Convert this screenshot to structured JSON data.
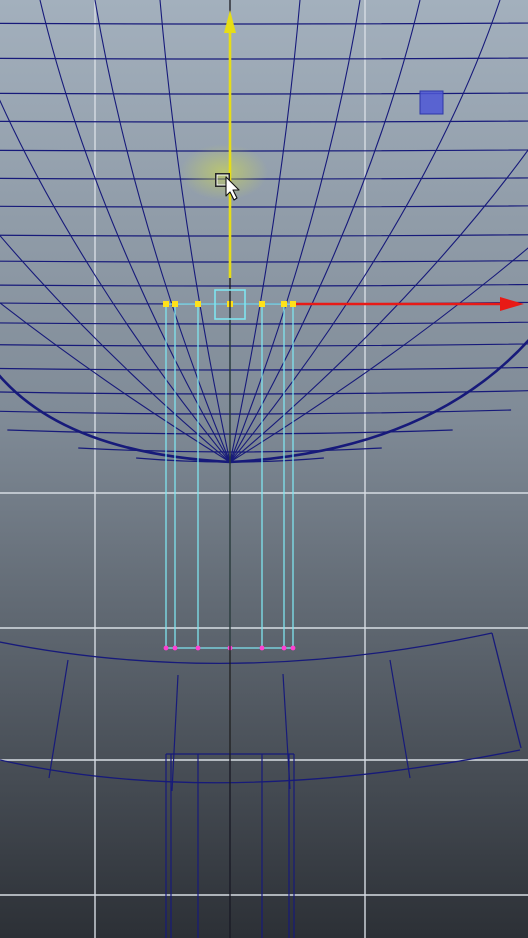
{
  "viewport": {
    "background_top": "#a3b0bd",
    "background_bottom": "#2c3036",
    "wireframe_color": "#171a7a",
    "grid_color": "#d7dde4",
    "selection_color": "#7fe4ef",
    "vertex_color": "#ffe11a",
    "y_axis_color": "#e6dd17",
    "x_axis_color": "#e81a16",
    "handle_highlight": "#cfe23a",
    "component_marker_color": "#4d57d6",
    "bottom_vertex_color": "#ff3fd2"
  },
  "scene": {
    "objects": [
      "sphere-wireframe",
      "selected-cylinder",
      "ring-wireframe",
      "lower-cylinder-wireframe"
    ],
    "manipulator": {
      "type": "move-tool",
      "axes": [
        "y-axis",
        "x-axis"
      ],
      "center_handle": "free-move-square"
    },
    "cursor": "arrow-pointer"
  }
}
